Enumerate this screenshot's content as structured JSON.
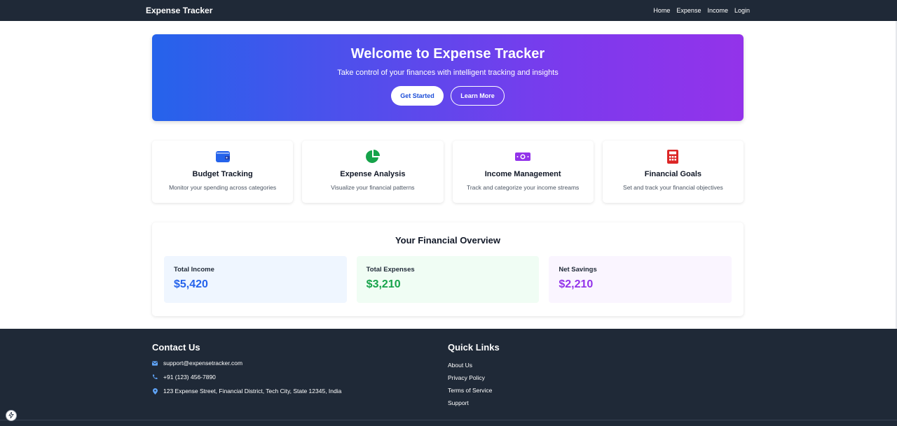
{
  "nav": {
    "brand": "Expense Tracker",
    "links": [
      "Home",
      "Expense",
      "Income",
      "Login"
    ]
  },
  "hero": {
    "title": "Welcome to Expense Tracker",
    "subtitle": "Take control of your finances with intelligent tracking and insights",
    "primary_button": "Get Started",
    "secondary_button": "Learn More"
  },
  "features": [
    {
      "icon": "wallet-icon",
      "color": "#2563eb",
      "title": "Budget Tracking",
      "description": "Monitor your spending across categories"
    },
    {
      "icon": "pie-chart-icon",
      "color": "#16a34a",
      "title": "Expense Analysis",
      "description": "Visualize your financial patterns"
    },
    {
      "icon": "money-bill-icon",
      "color": "#9333ea",
      "title": "Income Management",
      "description": "Track and categorize your income streams"
    },
    {
      "icon": "calculator-icon",
      "color": "#dc2626",
      "title": "Financial Goals",
      "description": "Set and track your financial objectives"
    }
  ],
  "overview": {
    "title": "Your Financial Overview",
    "stats": [
      {
        "label": "Total Income",
        "value": "$5,420",
        "color": "#2563eb",
        "bg": "#eff6ff"
      },
      {
        "label": "Total Expenses",
        "value": "$3,210",
        "color": "#16a34a",
        "bg": "#f0fdf4"
      },
      {
        "label": "Net Savings",
        "value": "$2,210",
        "color": "#9333ea",
        "bg": "#faf5ff"
      }
    ]
  },
  "footer": {
    "contact_heading": "Contact Us",
    "email": "support@expensetracker.com",
    "phone": "+91 (123) 456-7890",
    "address": "123 Expense Street, Financial District, Tech City, State 12345, India",
    "links_heading": "Quick Links",
    "links": [
      "About Us",
      "Privacy Policy",
      "Terms of Service",
      "Support"
    ]
  }
}
